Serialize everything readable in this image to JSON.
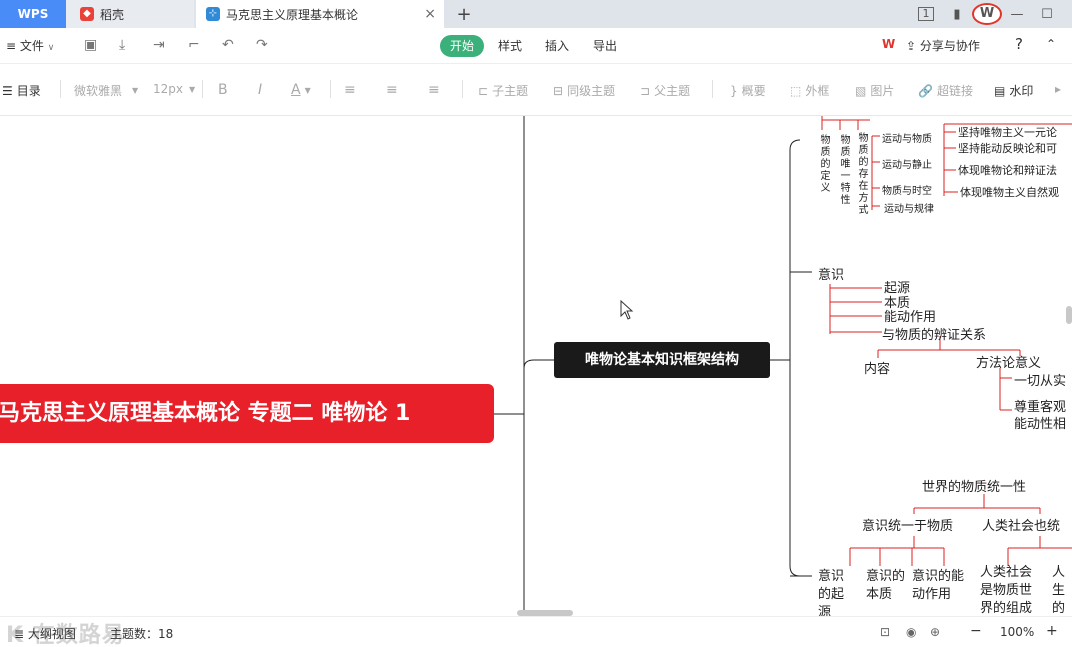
{
  "tabs": {
    "wps": "WPS",
    "daoke": "稻壳",
    "document": "马克思主义原理基本概论",
    "new_tab": "+",
    "close": "×"
  },
  "window": {
    "badge": "1",
    "minimize": "—",
    "restore": "☐",
    "close": "✕"
  },
  "menu": {
    "file": "文件",
    "start": "开始",
    "style": "样式",
    "insert": "插入",
    "export": "导出",
    "share": "分享与协作",
    "help": "?"
  },
  "toolbar": {
    "outline": "目录",
    "font": "微软雅黑",
    "font_size": "12px",
    "bold": "B",
    "italic": "I",
    "font_color": "A",
    "child_topic": "子主题",
    "sibling_topic": "同级主题",
    "parent_topic": "父主题",
    "summary": "概要",
    "frame": "外框",
    "image": "图片",
    "hyperlink": "超链接",
    "watermark": "水印"
  },
  "mindmap": {
    "root": "马克思主义原理基本概论 专题二 唯物论 1",
    "center": "唯物论基本知识框架结构",
    "branch1": {
      "def": "物质的定义",
      "unity": "物质唯一特性",
      "existence": "物质的存在方式",
      "items": [
        "运动与物质",
        "运动与静止",
        "物质与时空",
        "运动与规律"
      ],
      "meanings": [
        "坚持唯物主义一元论",
        "坚持能动反映论和可",
        "体现唯物论和辩证法",
        "体现唯物主义自然观"
      ]
    },
    "branch2": {
      "title": "意识",
      "items": [
        "起源",
        "本质",
        "能动作用",
        "与物质的辨证关系"
      ],
      "content": "内容",
      "method": "方法论意义",
      "method_items": [
        "一切从实",
        "尊重客观",
        "能动性相"
      ]
    },
    "branch3": {
      "title": "世界的物质统一性",
      "left": "意识统一于物质",
      "right": "人类社会也统",
      "bottom": [
        "意识的起源",
        "意识的本质",
        "意识的能动作用",
        "人类社会是物质世界的组成",
        "人生的"
      ]
    }
  },
  "status": {
    "outline_view": "大纲视图",
    "topic_count_label": "主题数：",
    "topic_count": "18",
    "zoom": "100%",
    "watermark_text": "K 在数路易"
  },
  "colors": {
    "accent_green": "#3cb07a",
    "root_red": "#e8202a",
    "center_black": "#1a1a1a",
    "wps_blue": "#4a8cf7",
    "branch_red": "#d92020"
  }
}
